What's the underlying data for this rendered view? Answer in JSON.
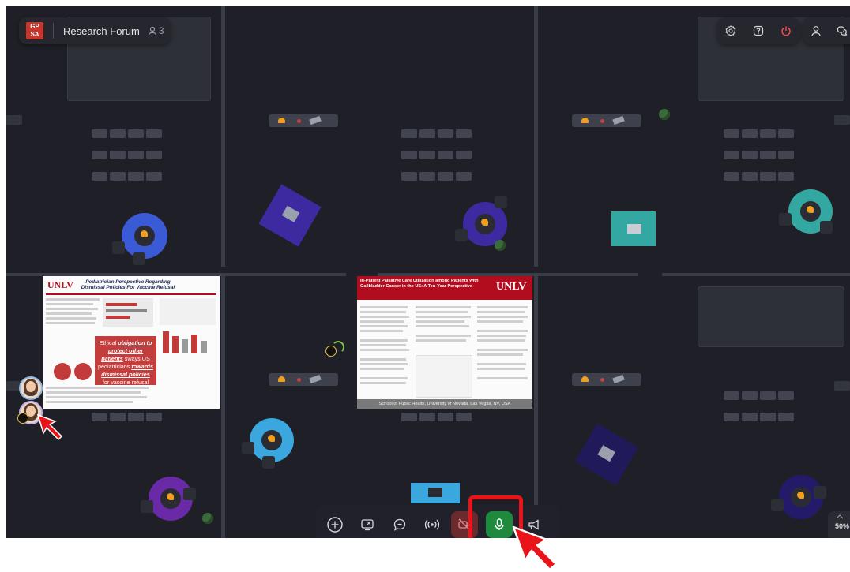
{
  "room": {
    "logo_line1": "GP",
    "logo_line2": "SA",
    "name": "Research Forum",
    "participants": "3"
  },
  "icons": {
    "settings": "gear-icon",
    "help": "help-icon",
    "leave": "power-icon",
    "profile": "person-icon",
    "chat": "chat-bubbles-icon"
  },
  "toolbar": {
    "add": "add-icon",
    "share_screen": "screen-share-icon",
    "chat": "chat-icon",
    "broadcast": "broadcast-icon",
    "camera": "camera-off-icon",
    "mic": "microphone-icon",
    "megaphone": "megaphone-icon"
  },
  "zoom": "50%",
  "colors": {
    "mic_active": "#1f8a3e",
    "camera_off": "#7a2a2a",
    "highlight": "#e8141a",
    "leave": "#ff4d4f"
  },
  "poster_left": {
    "brand": "UNLV",
    "title": "Pediatrician Perspective Regarding Dismissal Policies For Vaccine Refusal",
    "quote_a": "Ethical ",
    "quote_b": "obligation to protect other patients",
    "quote_c": " sways US pediatricians ",
    "quote_d": "towards dismissal policies",
    "quote_e": " for vaccine refusal"
  },
  "poster_center": {
    "title": "In-Patient Palliative Care Utilization among Patients with Gallbladder Cancer in the US: A Ten-Year Perspective",
    "brand": "UNLV",
    "footer": "School of Public Health, University of Nevada, Las Vegas, NV, USA"
  }
}
